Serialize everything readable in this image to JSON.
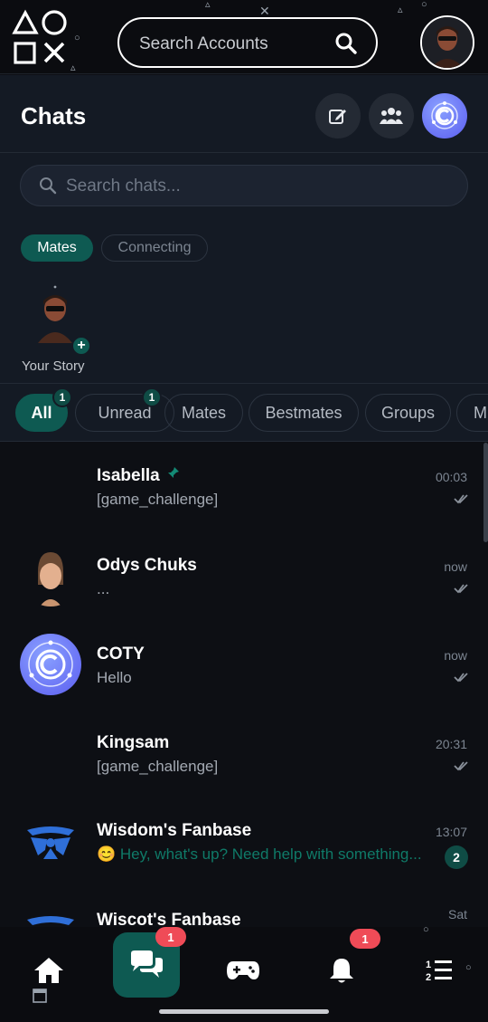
{
  "topbar": {
    "search_placeholder": "Search Accounts",
    "logo_icon": "playstation-shapes-logo",
    "search_icon": "search-icon",
    "avatar_icon": "user-avatar"
  },
  "header": {
    "title": "Chats",
    "buttons": [
      "compose-icon",
      "group-icon",
      "coty-logo-icon"
    ]
  },
  "chat_search": {
    "placeholder": "Search chats..."
  },
  "segments": [
    {
      "label": "Mates",
      "active": true
    },
    {
      "label": "Connecting",
      "active": false
    }
  ],
  "story": {
    "label": "Your Story",
    "add_icon": "+"
  },
  "filters": [
    {
      "label": "All",
      "badge": "1",
      "active": true
    },
    {
      "label": "Unread",
      "badge": "1",
      "active": false
    },
    {
      "label": "Mates",
      "badge": "",
      "active": false
    },
    {
      "label": "Bestmates",
      "badge": "",
      "active": false
    },
    {
      "label": "Groups",
      "badge": "",
      "active": false
    },
    {
      "label": "M",
      "badge": "",
      "active": false
    }
  ],
  "chats": [
    {
      "name": "Isabella",
      "preview": "[game_challenge]",
      "time": "00:03",
      "pinned": true,
      "status": "read",
      "unread": "",
      "avatar": "none"
    },
    {
      "name": "Odys Chuks",
      "preview": "...",
      "time": "now",
      "pinned": false,
      "status": "read",
      "unread": "",
      "avatar": "female-avatar"
    },
    {
      "name": "COTY",
      "preview": "Hello",
      "time": "now",
      "pinned": false,
      "status": "read",
      "unread": "",
      "avatar": "coty-logo"
    },
    {
      "name": "Kingsam",
      "preview": "[game_challenge]",
      "time": "20:31",
      "pinned": false,
      "status": "read",
      "unread": "",
      "avatar": "none"
    },
    {
      "name": "Wisdom's Fanbase",
      "preview": "😊 Hey, what's up? Need help with something...",
      "time": "13:07",
      "pinned": false,
      "status": "",
      "unread": "2",
      "avatar": "fanbase-logo"
    },
    {
      "name": "Wiscot's Fanbase",
      "preview": "",
      "time": "Sat",
      "pinned": false,
      "status": "",
      "unread": "",
      "avatar": "fanbase-logo"
    }
  ],
  "bottomnav": {
    "items": [
      "home-icon",
      "chats-icon",
      "games-icon",
      "notifications-icon",
      "leaderboard-icon"
    ],
    "chats_badge": "1",
    "notifications_badge": "1"
  },
  "colors": {
    "accent": "#0e5a52",
    "badge_red": "#ef4b57",
    "background": "#0d0f14",
    "panel": "#141a24"
  }
}
